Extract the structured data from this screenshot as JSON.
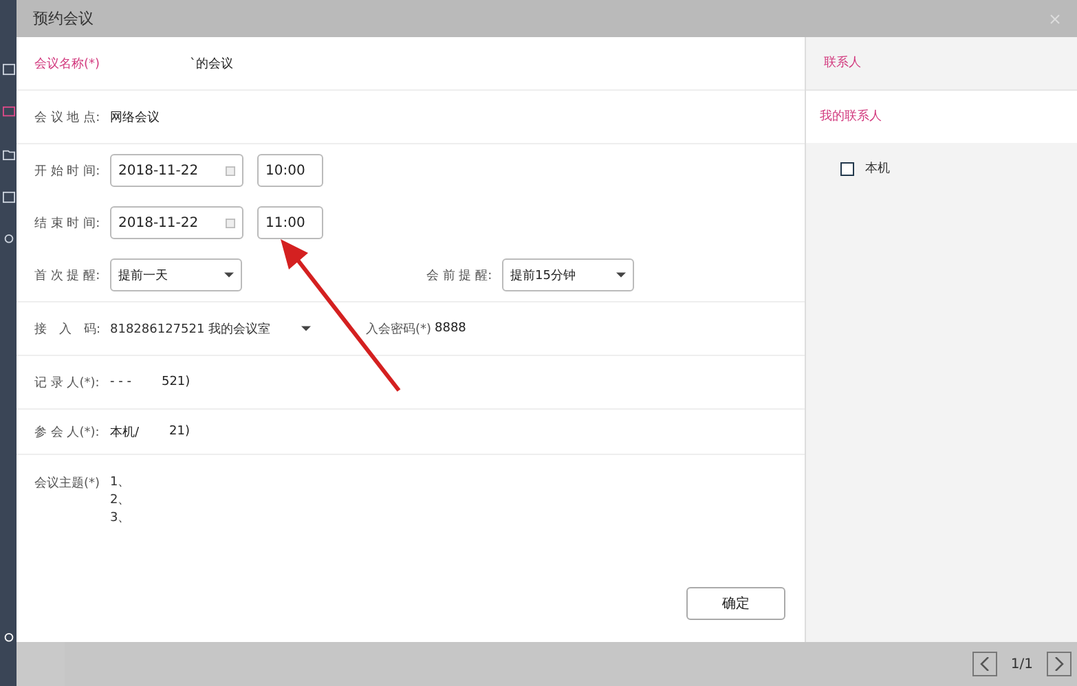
{
  "window": {
    "title": "预约会议"
  },
  "form": {
    "name": {
      "label": "会议名称(*)",
      "value": "`的会议"
    },
    "location": {
      "label": "会 议 地 点:",
      "value": "网络会议"
    },
    "start": {
      "label": "开 始 时 间:",
      "date": "2018-11-22",
      "time": "10:00"
    },
    "end": {
      "label": "结 束 时 间:",
      "date": "2018-11-22",
      "time": "11:00"
    },
    "first_reminder": {
      "label": "首 次 提 醒:",
      "value": "提前一天"
    },
    "pre_reminder": {
      "label": "会 前 提 醒:",
      "value": "提前15分钟"
    },
    "access_code": {
      "label": "接　入　码:",
      "value": "818286127521 我的会议室"
    },
    "password": {
      "label": "入会密码(*)",
      "value": "8888"
    },
    "recorder": {
      "label": "记 录 人(*):",
      "values": [
        "- - -",
        "521)"
      ]
    },
    "attendees": {
      "label": "参 会 人(*):",
      "values": [
        "本机/",
        "21)"
      ]
    },
    "topic": {
      "label": "会议主题(*)",
      "lines": [
        "1、",
        "2、",
        "3、"
      ]
    },
    "confirm": "确定"
  },
  "contacts": {
    "title": "联系人",
    "groups": [
      {
        "label": "我的联系人",
        "selected": true,
        "children": [
          {
            "label": "本机",
            "checked": false
          }
        ]
      }
    ]
  },
  "pager": {
    "text": "1/1"
  }
}
